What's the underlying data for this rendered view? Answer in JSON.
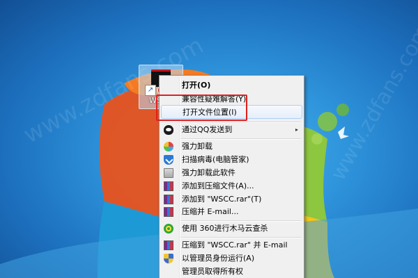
{
  "desktop": {
    "watermarks": [
      "www.zdfans.com",
      "www.zdfans.com"
    ]
  },
  "shortcut": {
    "label": "WS"
  },
  "menu": {
    "items": [
      {
        "label": "打开(O)",
        "icon": "",
        "bold": true
      },
      {
        "label": "兼容性疑难解答(Y)",
        "icon": ""
      },
      {
        "label": "打开文件位置(I)",
        "icon": "",
        "hover": true
      },
      {
        "label": "通过QQ发送到",
        "icon": "qq-icon",
        "submenu": true
      },
      {
        "label": "强力卸载",
        "icon": "pinwheel-icon"
      },
      {
        "label": "扫描病毒(电脑管家)",
        "icon": "shield-check-icon"
      },
      {
        "label": "强力卸载此软件",
        "icon": "recycle-bin-icon"
      },
      {
        "label": "添加到压缩文件(A)...",
        "icon": "winrar-icon"
      },
      {
        "label": "添加到 \"WSCC.rar\"(T)",
        "icon": "winrar-icon"
      },
      {
        "label": "压缩并 E-mail...",
        "icon": "winrar-icon"
      },
      {
        "label": "使用 360进行木马云查杀",
        "icon": "360-icon"
      },
      {
        "label": "压缩到 \"WSCC.rar\" 并 E-mail",
        "icon": "winrar-icon"
      },
      {
        "label": "以管理员身份运行(A)",
        "icon": "uac-shield-icon"
      },
      {
        "label": "管理员取得所有权",
        "icon": ""
      }
    ],
    "submenu_arrow": "▸"
  },
  "colors": {
    "highlight_box": "#e21e1e",
    "menu_background": "#f0f0f0",
    "hover_border": "#aecff7"
  }
}
